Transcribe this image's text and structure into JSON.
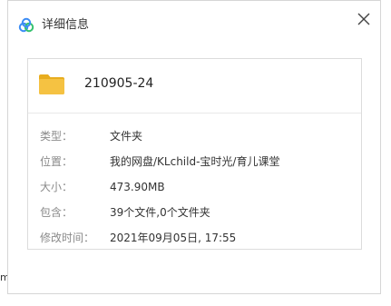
{
  "window": {
    "title": "详细信息"
  },
  "icons": {
    "app": "cloud-logo-icon",
    "close": "close-icon",
    "folder": "folder-icon"
  },
  "colors": {
    "folder": "#f5c242",
    "folder_dark": "#e8ad1f",
    "logo_blue": "#3b8cf5",
    "logo_green": "#36c26f"
  },
  "item": {
    "name": "210905-24"
  },
  "details": [
    {
      "label": "类型：",
      "value": "文件夹"
    },
    {
      "label": "位置：",
      "value": "我的网盘/KLchild-宝时光/育儿课堂"
    },
    {
      "label": "大小：",
      "value": "473.90MB"
    },
    {
      "label": "包含：",
      "value": "39个文件,0个文件夹"
    },
    {
      "label": "修改时间：",
      "value": "2021年09月05日, 17:55"
    }
  ],
  "edge_glyph": "m"
}
